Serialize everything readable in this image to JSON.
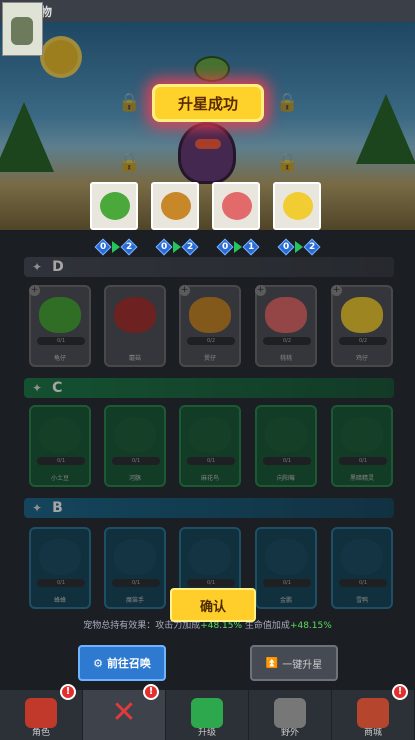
{
  "header": {
    "title": "宠物"
  },
  "banner": {
    "text": "升星成功"
  },
  "rewards": [
    {
      "name": "green-shell",
      "color": "#4ba83a"
    },
    {
      "name": "burger",
      "color": "#c8882a"
    },
    {
      "name": "pink-pig",
      "color": "#e36a6a"
    },
    {
      "name": "yellow-bird",
      "color": "#f2cc33"
    }
  ],
  "progress": [
    {
      "from": "0",
      "to": "2"
    },
    {
      "from": "0",
      "to": "2"
    },
    {
      "from": "0",
      "to": "1"
    },
    {
      "from": "0",
      "to": "2"
    }
  ],
  "tiers": [
    {
      "label": "D",
      "key": "d"
    },
    {
      "label": "C",
      "key": "c"
    },
    {
      "label": "B",
      "key": "b"
    }
  ],
  "cards_d": [
    {
      "name": "龟仔",
      "count": "0/1",
      "color": "#4ba83a"
    },
    {
      "name": "蘑菇",
      "count": "",
      "color": "#a33"
    },
    {
      "name": "煲仔",
      "count": "0/2",
      "color": "#c8882a"
    },
    {
      "name": "桃桃",
      "count": "0/2",
      "color": "#e36a6a"
    },
    {
      "name": "鸡仔",
      "count": "0/2",
      "color": "#f2cc33"
    }
  ],
  "cards_c": [
    {
      "name": "小土豆",
      "count": "0/1"
    },
    {
      "name": "河豚",
      "count": "0/1"
    },
    {
      "name": "麻花鸟",
      "count": "0/1"
    },
    {
      "name": "向阳莓",
      "count": "0/1"
    },
    {
      "name": "黑暗精灵",
      "count": "0/1"
    }
  ],
  "cards_b": [
    {
      "name": "蜂蜂",
      "count": "0/1"
    },
    {
      "name": "魔笛手",
      "count": "0/1"
    },
    {
      "name": "",
      "count": "0/1"
    },
    {
      "name": "金鹏",
      "count": "0/1"
    },
    {
      "name": "雪鸭",
      "count": "0/1"
    }
  ],
  "effect": {
    "prefix": "宠物总持有效果：攻击力加成",
    "atk": "+48.15%",
    "mid": " 生命值加成",
    "hp": "+48.15%"
  },
  "buttons": {
    "confirm": "确认",
    "summon": "前往召唤",
    "upgrade_all": "一键升星"
  },
  "nav": [
    {
      "label": "角色",
      "badge": "!",
      "icon": "character-icon",
      "color": "#c0392b"
    },
    {
      "label": "",
      "badge": "!",
      "icon": "close-icon",
      "color": "#e03b3b"
    },
    {
      "label": "升级",
      "badge": "",
      "icon": "upgrade-icon",
      "color": "#2ea84d"
    },
    {
      "label": "野外",
      "badge": "",
      "icon": "lock-icon",
      "color": "#777"
    },
    {
      "label": "商城",
      "badge": "!",
      "icon": "shop-icon",
      "color": "#b5462d"
    }
  ]
}
